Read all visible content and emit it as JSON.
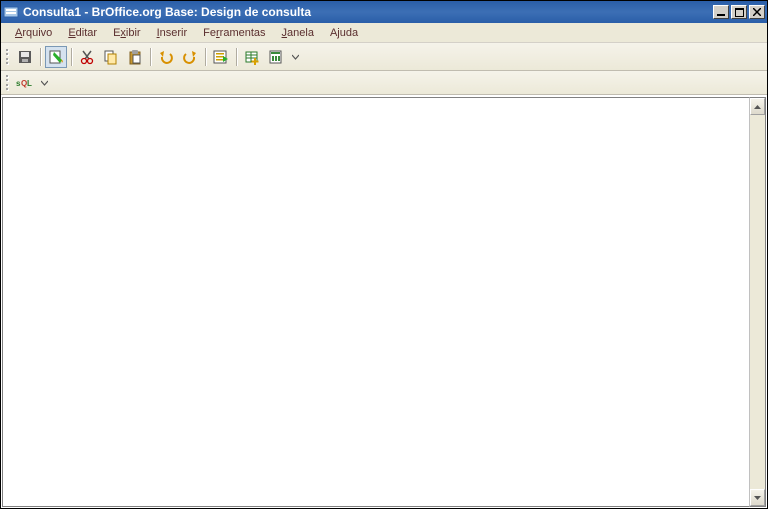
{
  "titlebar": {
    "title": "Consulta1 - BrOffice.org Base: Design de consulta"
  },
  "menubar": {
    "items": [
      {
        "pre": "",
        "u": "A",
        "post": "rquivo"
      },
      {
        "pre": "",
        "u": "E",
        "post": "ditar"
      },
      {
        "pre": "E",
        "u": "x",
        "post": "ibir"
      },
      {
        "pre": "",
        "u": "I",
        "post": "nserir"
      },
      {
        "pre": "Fe",
        "u": "r",
        "post": "ramentas"
      },
      {
        "pre": "",
        "u": "J",
        "post": "anela"
      },
      {
        "pre": "A",
        "u": "j",
        "post": "uda"
      }
    ]
  },
  "toolbar1": {
    "buttons": [
      {
        "name": "save-icon"
      },
      {
        "sep": true
      },
      {
        "name": "edit-mode-icon",
        "active": true
      },
      {
        "sep": true
      },
      {
        "name": "cut-icon"
      },
      {
        "name": "copy-icon"
      },
      {
        "name": "paste-icon"
      },
      {
        "sep": true
      },
      {
        "name": "undo-icon"
      },
      {
        "name": "redo-icon"
      },
      {
        "sep": true
      },
      {
        "name": "run-query-icon"
      },
      {
        "sep": true
      },
      {
        "name": "add-table-icon"
      },
      {
        "name": "functions-icon"
      }
    ]
  },
  "toolbar2": {
    "buttons": [
      {
        "name": "run-sql-direct-icon",
        "label": "SQL"
      }
    ]
  }
}
